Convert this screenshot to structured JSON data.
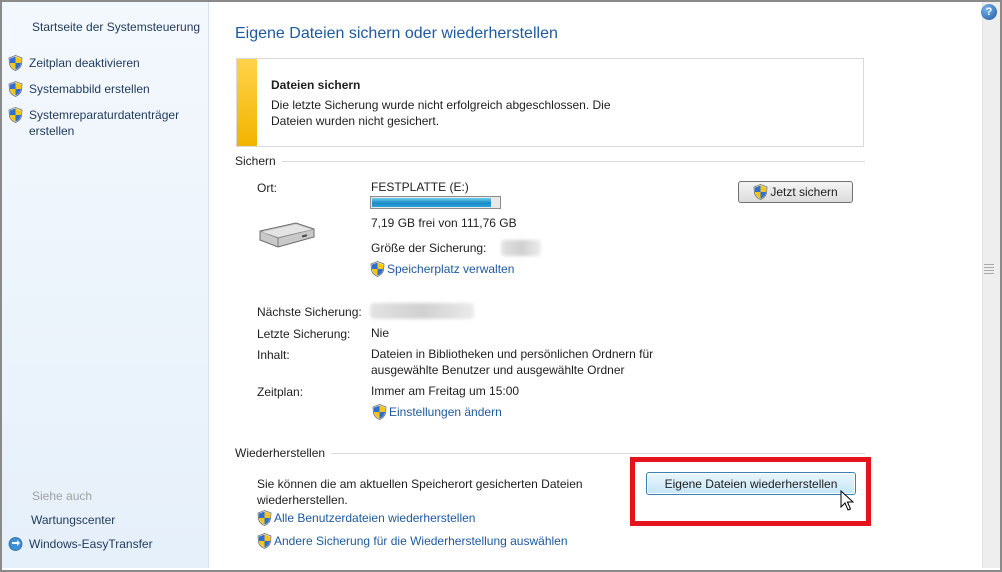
{
  "sidebar": {
    "home_link": "Startseite der Systemsteuerung",
    "tasks": [
      {
        "label": "Zeitplan deaktivieren"
      },
      {
        "label": "Systemabbild erstellen"
      },
      {
        "label": "Systemreparaturdatenträger erstellen"
      }
    ],
    "see_also_label": "Siehe auch",
    "see_also": [
      {
        "label": "Wartungscenter"
      },
      {
        "label": "Windows-EasyTransfer"
      }
    ]
  },
  "main": {
    "title": "Eigene Dateien sichern oder wiederherstellen",
    "warning": {
      "title": "Dateien sichern",
      "text": "Die letzte Sicherung wurde nicht erfolgreich abgeschlossen. Die Dateien wurden nicht gesichert."
    },
    "backup": {
      "section_label": "Sichern",
      "location_label": "Ort:",
      "location_value": "FESTPLATTE (E:)",
      "free_space_text": "7,19 GB frei von 111,76 GB",
      "used_fraction": 0.936,
      "backup_size_label": "Größe der Sicherung:",
      "manage_space_link": "Speicherplatz verwalten",
      "backup_now_button": "Jetzt sichern",
      "next_backup_label": "Nächste Sicherung:",
      "last_backup_label": "Letzte Sicherung:",
      "last_backup_value": "Nie",
      "contents_label": "Inhalt:",
      "contents_value": "Dateien in Bibliotheken und persönlichen Ordnern für ausgewählte Benutzer und ausgewählte Ordner",
      "schedule_label": "Zeitplan:",
      "schedule_value": "Immer am Freitag um 15:00",
      "change_settings_link": "Einstellungen ändern"
    },
    "restore": {
      "section_label": "Wiederherstellen",
      "text": "Sie können die am aktuellen Speicherort gesicherten Dateien wiederherstellen.",
      "restore_button": "Eigene Dateien wiederherstellen",
      "all_users_link": "Alle Benutzerdateien wiederherstellen",
      "other_backup_link": "Andere Sicherung für die Wiederherstellung auswählen"
    }
  },
  "help_icon": "?"
}
